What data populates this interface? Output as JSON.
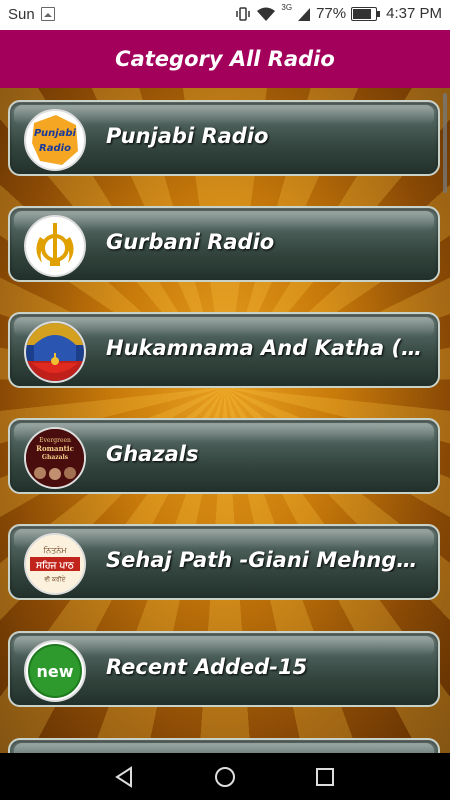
{
  "status_bar": {
    "day": "Sun",
    "network_type": "3G",
    "battery": "77%",
    "time": "4:37 PM",
    "icons": [
      "image-icon",
      "vibrate-icon",
      "wifi-icon",
      "signal-icon",
      "battery-icon"
    ]
  },
  "app_bar": {
    "title": "Category All Radio"
  },
  "colors": {
    "app_bar": "#a2005a",
    "item_bg": "#34463f"
  },
  "categories": [
    {
      "label": "Punjabi Radio",
      "icon": "punjabi-radio-logo",
      "logo_text": "Punjabi Radio"
    },
    {
      "label": "Gurbani Radio",
      "icon": "khanda-icon"
    },
    {
      "label": "Hukamnama And Katha (Dai…",
      "icon": "golden-temple-icon"
    },
    {
      "label": "Ghazals",
      "icon": "ghazals-album-cover",
      "logo_text": "Evergreen Romantic Ghazals"
    },
    {
      "label": "Sehaj Path -Giani Mehnga Si…",
      "icon": "sehaj-path-logo",
      "logo_text": "ਨਿਤਨੇਮ ਸਹਿਜ ਪਾਠ"
    },
    {
      "label": "Recent Added-15",
      "icon": "new-badge-icon",
      "logo_text": "new"
    }
  ],
  "nav": {
    "back": "back-icon",
    "home": "home-icon",
    "recent": "recent-apps-icon"
  }
}
